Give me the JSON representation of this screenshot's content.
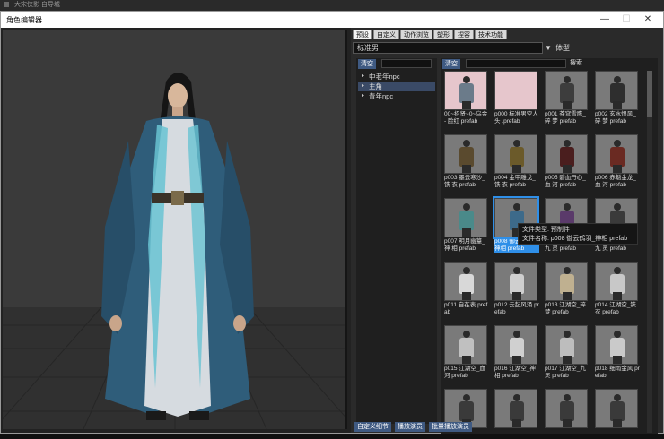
{
  "outer_title": "大宋侠影 自导城",
  "window": {
    "title": "角色编辑器",
    "minimize_glyph": "—",
    "maximize_glyph": "☐",
    "close_glyph": "✕"
  },
  "tabs": [
    {
      "label": "预设"
    },
    {
      "label": "自定义"
    },
    {
      "label": "动作浏览"
    },
    {
      "label": "塑形"
    },
    {
      "label": "捏容"
    },
    {
      "label": "技术功能"
    }
  ],
  "preset": {
    "value": "标准男",
    "arrow": "▼",
    "label": "体型"
  },
  "tree_pane": {
    "clear_label": "清空",
    "items": [
      {
        "label": "中老年npc",
        "arrow": "▸",
        "selected": false
      },
      {
        "label": "主角",
        "arrow": "▸",
        "selected": true
      },
      {
        "label": "青年npc",
        "arrow": "▸",
        "selected": false
      }
    ]
  },
  "grid_pane": {
    "clear_label": "清空",
    "search_label": "搜索",
    "assets": [
      {
        "label": "00~招贤~0~乌金 - 脸红 prefab",
        "style": "pink-figure",
        "color": "#6b7b8a"
      },
      {
        "label": "p000 标准男空人头 .prefab",
        "style": "pink",
        "color": "#e6c6cc"
      },
      {
        "label": "p001 苍穹雪鹰_碎 梦 prefab",
        "style": "figure",
        "color": "#3d3d3d"
      },
      {
        "label": "p002 玄水恨风_碎 梦 prefab",
        "style": "figure",
        "color": "#2e2e2e"
      },
      {
        "label": "p003 墨云寒沙_铁 衣 prefab",
        "style": "figure",
        "color": "#5a4a2e"
      },
      {
        "label": "p004 金甲雕戈_铁 衣 prefab",
        "style": "figure",
        "color": "#6b5a2a"
      },
      {
        "label": "p005 碧血丹心_血 河 prefab",
        "style": "figure",
        "color": "#4a1e1e"
      },
      {
        "label": "p006 赤魁金龙_血 河 prefab",
        "style": "figure",
        "color": "#6a2a22"
      },
      {
        "label": "p007 明月幽篁_神 相 prefab",
        "style": "figure",
        "color": "#4a8a8a"
      },
      {
        "label": "p008 御云鹤羽_神相 prefab",
        "style": "figure",
        "color": "#3d6a8a",
        "selected": true
      },
      {
        "label": "p009 落霞飞燕_九 灵 prefab",
        "style": "figure",
        "color": "#5a3a6a"
      },
      {
        "label": "p010 步摇生花_九 灵 prefab",
        "style": "figure",
        "color": "#3a3a3a"
      },
      {
        "label": "p011 自在表 prefab",
        "style": "figure",
        "color": "#d8d8d8"
      },
      {
        "label": "p012 云起风涌 prefab",
        "style": "figure",
        "color": "#cfcfcf"
      },
      {
        "label": "p013 江湖空_碎梦 prefab",
        "style": "figure",
        "color": "#bfb090"
      },
      {
        "label": "p014 江湖空_铁衣 prefab",
        "style": "figure",
        "color": "#c8c8c8"
      },
      {
        "label": "p015 江湖空_血河 prefab",
        "style": "figure",
        "color": "#c0c0c0"
      },
      {
        "label": "p016 江湖空_神相 prefab",
        "style": "figure",
        "color": "#d0d0d0"
      },
      {
        "label": "p017 江湖空_九灵 prefab",
        "style": "figure",
        "color": "#bdbdbd"
      },
      {
        "label": "p018 细雨金风 prefab",
        "style": "figure",
        "color": "#cacaca"
      },
      {
        "label": "",
        "style": "figure",
        "color": "#3a3a3a"
      },
      {
        "label": "",
        "style": "figure",
        "color": "#3a3a3a"
      },
      {
        "label": "",
        "style": "figure",
        "color": "#3a3a3a"
      },
      {
        "label": "",
        "style": "figure",
        "color": "#3a3a3a"
      }
    ]
  },
  "tooltip": {
    "line1": "文件类型: 预制件",
    "line2": "文件名称: p008 御云鹤羽_神相 prefab"
  },
  "bottom_buttons": [
    {
      "label": "自定义细节"
    },
    {
      "label": "播放演员"
    },
    {
      "label": "批量播放演员"
    }
  ],
  "colors": {
    "button_accent": "#3f5a82",
    "selection_blue": "#2f8fe8",
    "robe_blue": "#2f5d7a",
    "robe_light": "#d6dbe0"
  }
}
